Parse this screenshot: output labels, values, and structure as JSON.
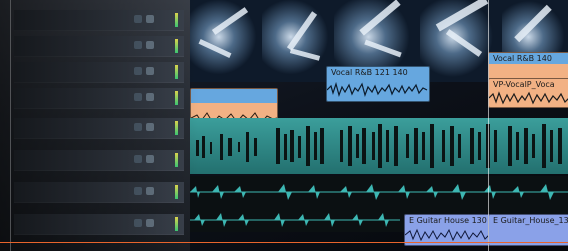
{
  "tracks": [
    {
      "name": ""
    },
    {
      "name": ""
    },
    {
      "name": ""
    },
    {
      "name": ""
    },
    {
      "name": ""
    },
    {
      "name": ""
    },
    {
      "name": ""
    },
    {
      "name": ""
    }
  ],
  "clips": {
    "vocal_top": "Vocal R&B 140",
    "vocal_mid": "Vocal R&B 121 140",
    "vocal_right": "VP-VocalP_Voca",
    "guitar_1": "E Guitar House 130 1",
    "guitar_2": "E Guitar_House_130"
  },
  "colors": {
    "vocal_clip": "#f2b184",
    "blue_clip": "#66a7df",
    "teal_lane": "#2f8e8c",
    "drum_clip": "#3db7b3",
    "guitar_clip": "#8aa1e8",
    "accent_line": "#e8642c"
  }
}
